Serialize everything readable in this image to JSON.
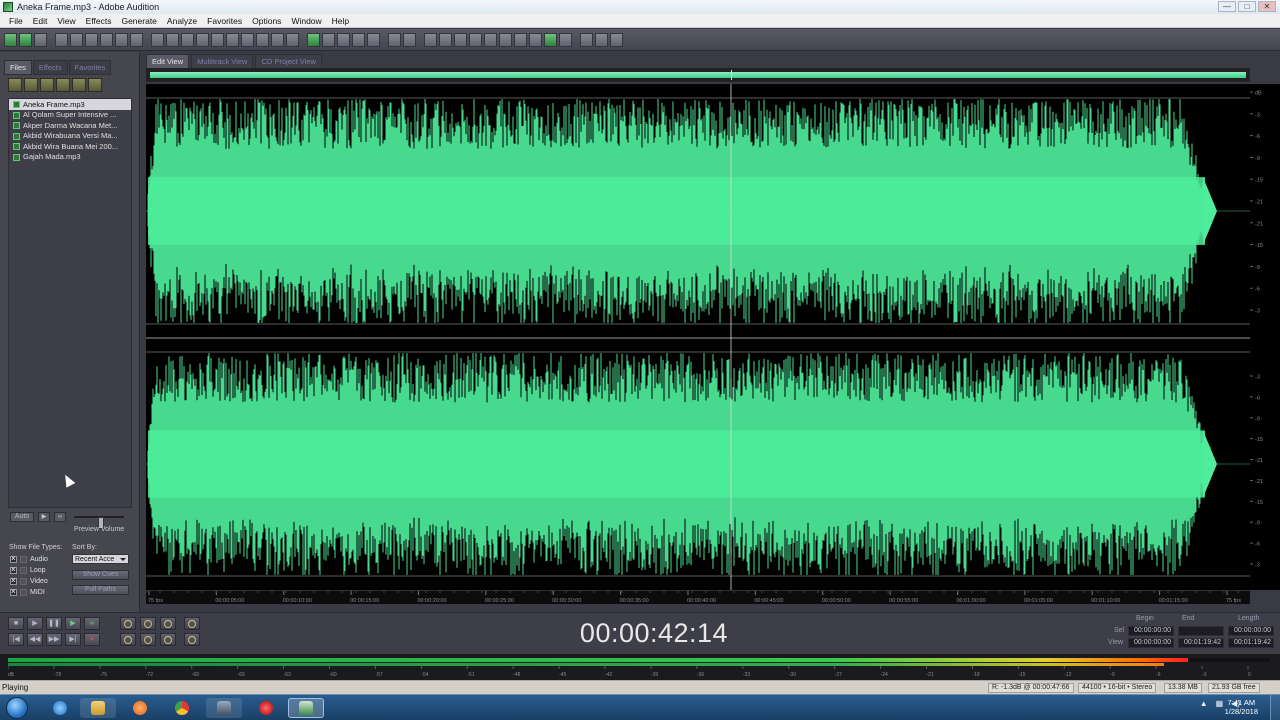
{
  "window": {
    "title": "Aneka Frame.mp3 - Adobe Audition",
    "controls": {
      "minimize": "—",
      "maximize": "□",
      "close": "✕"
    }
  },
  "menu": [
    "File",
    "Edit",
    "View",
    "Effects",
    "Generate",
    "Analyze",
    "Favorites",
    "Options",
    "Window",
    "Help"
  ],
  "panel": {
    "tabs": [
      "Files",
      "Effects",
      "Favorites"
    ],
    "files": [
      "Aneka Frame.mp3",
      "Al Qolam Super Intensive ...",
      "Akper Darma Wacana Met...",
      "Akbid Wirabuana Versi Ma...",
      "Akbid Wira Buana Mei 200...",
      "Gajah Mada.mp3"
    ],
    "preview": {
      "auto_label": "Auto",
      "volume_label": "Preview Volume",
      "volume_level": 0.55
    },
    "show_file_types_label": "Show File Types:",
    "sort_by_label": "Sort By:",
    "sort_value": "Recent Acce",
    "file_types": [
      "Audio",
      "Loop",
      "Video",
      "MIDI"
    ],
    "show_cues_label": "Show Cues",
    "full_paths_label": "Full Paths"
  },
  "view_tabs": [
    "Edit View",
    "Multitrack View",
    "CD Project View"
  ],
  "timeline": {
    "labels": [
      "75 fps",
      "00:00:05:00",
      "00:00:10:00",
      "00:00:15:00",
      "00:00:20:00",
      "00:00:25:00",
      "00:00:30:00",
      "00:00:35:00",
      "00:00:40:00",
      "00:00:45:00",
      "00:00:50:00",
      "00:00:55:00",
      "00:01:00:00",
      "00:01:05:00",
      "00:01:10:00",
      "00:01:15:00",
      "75 fps"
    ]
  },
  "db_scale_top": [
    "dB",
    "-3",
    "-6",
    "-9",
    "-15",
    "-21",
    "-21",
    "-15",
    "-9",
    "-6",
    "-3"
  ],
  "db_scale_bottom": [
    "-3",
    "-6",
    "-9",
    "-15",
    "-21",
    "-21",
    "-15",
    "-9",
    "-6",
    "-3"
  ],
  "playhead_fraction": 0.53,
  "waveform_end_fraction": 0.965,
  "waveform_color": "#4ded9b",
  "time_display": "00:00:42:14",
  "selection": {
    "headers": [
      "Begin",
      "End",
      "Length"
    ],
    "sel_label": "Sel",
    "view_label": "View",
    "sel": [
      "00:00:00:00",
      "",
      "00:00:00:00"
    ],
    "view": [
      "00:00:00:00",
      "00:01:19:42",
      "00:01:19:42"
    ]
  },
  "meter": {
    "level": 0.935,
    "ticks": [
      "dB",
      "-78",
      "-75",
      "-72",
      "-69",
      "-66",
      "-63",
      "-60",
      "-57",
      "-54",
      "-51",
      "-48",
      "-45",
      "-42",
      "-39",
      "-36",
      "-33",
      "-30",
      "-27",
      "-24",
      "-21",
      "-18",
      "-15",
      "-12",
      "-9",
      "-6",
      "-3",
      "0"
    ]
  },
  "status": {
    "state": "Playing",
    "cursor_info": "R: -1.3dB @ 00:00:47:66",
    "format": "44100 • 16-bit • Stereo",
    "size": "13.38 MB",
    "free": "21.93 GB free"
  },
  "taskbar": {
    "time": "7:41 AM",
    "date": "1/28/2018"
  }
}
